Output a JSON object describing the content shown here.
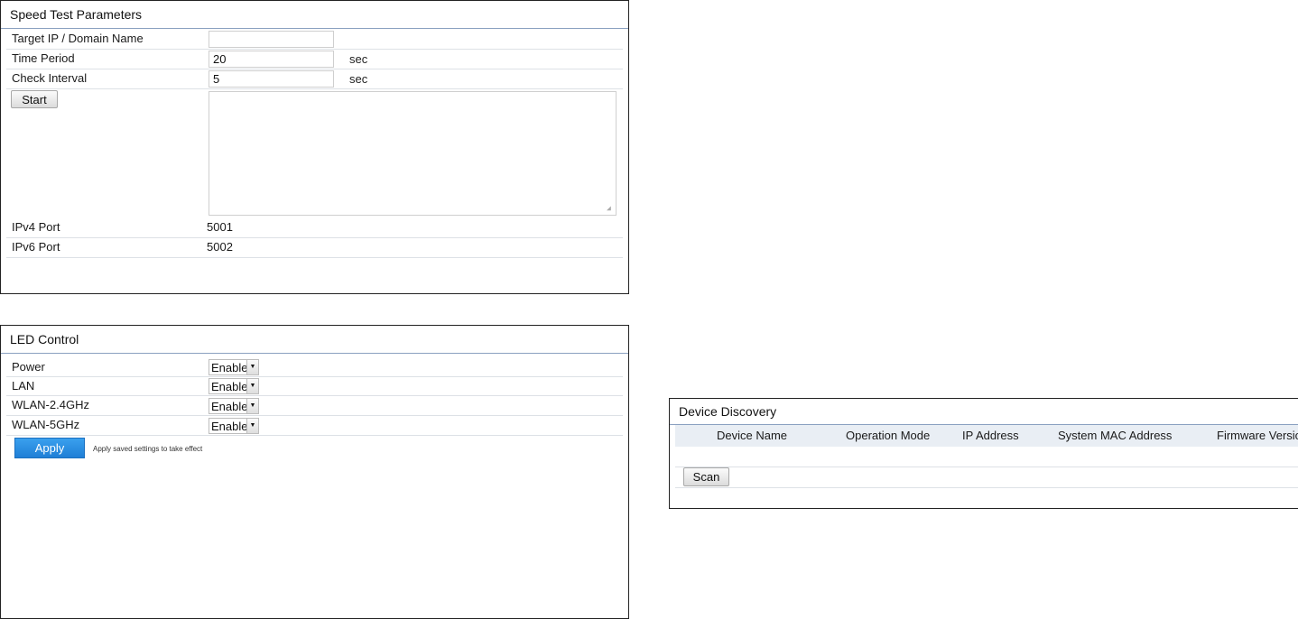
{
  "speed_test": {
    "title": "Speed Test Parameters",
    "target_label": "Target IP / Domain Name",
    "target_value": "",
    "time_period_label": "Time Period",
    "time_period_value": "20",
    "time_period_unit": "sec",
    "check_interval_label": "Check Interval",
    "check_interval_value": "5",
    "check_interval_unit": "sec",
    "start_label": "Start",
    "ipv4_label": "IPv4 Port",
    "ipv4_value": "5001",
    "ipv6_label": "IPv6 Port",
    "ipv6_value": "5002"
  },
  "led_control": {
    "title": "LED Control",
    "items": [
      {
        "label": "Power",
        "value": "Enable"
      },
      {
        "label": "LAN",
        "value": "Enable"
      },
      {
        "label": "WLAN-2.4GHz",
        "value": "Enable"
      },
      {
        "label": "WLAN-5GHz",
        "value": "Enable"
      }
    ],
    "apply_label": "Apply",
    "apply_hint": "Apply saved settings to take effect"
  },
  "device_discovery": {
    "title": "Device Discovery",
    "columns": [
      "Device Name",
      "Operation Mode",
      "IP Address",
      "System MAC Address",
      "Firmware Versio"
    ],
    "scan_label": "Scan"
  },
  "icons": {
    "dropdown_arrow": "chevron-down-icon",
    "resize_grip": "resize-grip-icon"
  },
  "colors": {
    "apply_button": "#2b8ee2",
    "header_rule": "#8aa0c0",
    "table_header_bg": "#e9eef4"
  }
}
